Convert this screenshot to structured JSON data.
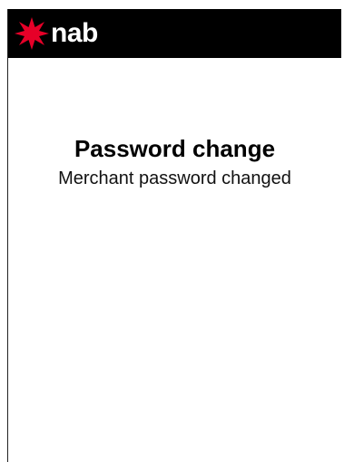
{
  "header": {
    "brand_text": "nab",
    "brand_color": "#e60028",
    "background_color": "#000000"
  },
  "main": {
    "title": "Password change",
    "message": "Merchant password changed"
  }
}
